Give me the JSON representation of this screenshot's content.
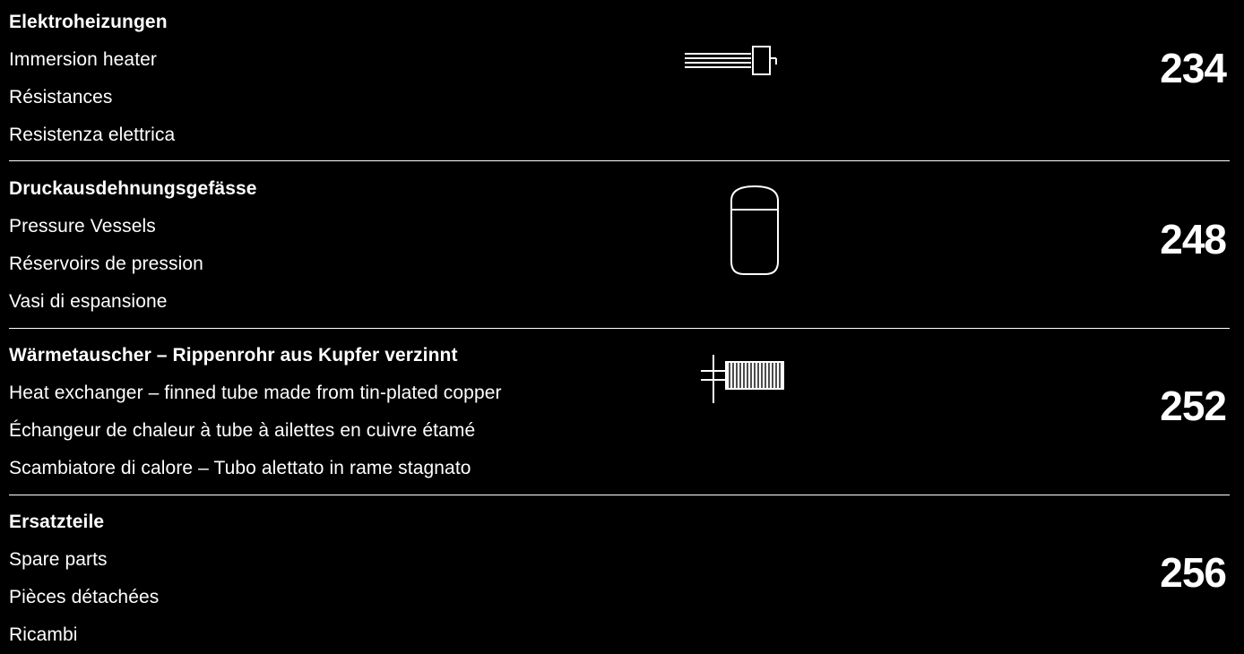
{
  "colors": {
    "background": "#000000",
    "text": "#ffffff"
  },
  "sections": [
    {
      "icon": "immersion-heater-icon",
      "titles": [
        "Elektroheizungen",
        "Immersion heater",
        "Résistances",
        "Resistenza elettrica"
      ],
      "page": "234"
    },
    {
      "icon": "pressure-vessel-icon",
      "titles": [
        "Druckausdehnungsgefässe",
        "Pressure Vessels",
        "Réservoirs de pression",
        "Vasi di espansione"
      ],
      "page": "248"
    },
    {
      "icon": "finned-tube-heat-exchanger-icon",
      "titles": [
        "Wärmetauscher – Rippenrohr aus Kupfer verzinnt",
        "Heat exchanger – finned tube made from tin-plated copper",
        "Échangeur de chaleur à tube à ailettes en cuivre étamé",
        "Scambiatore di calore – Tubo alettato in rame stagnato"
      ],
      "page": "252"
    },
    {
      "icon": "",
      "titles": [
        "Ersatzteile",
        "Spare parts",
        "Pièces détachées",
        "Ricambi"
      ],
      "page": "256"
    }
  ]
}
